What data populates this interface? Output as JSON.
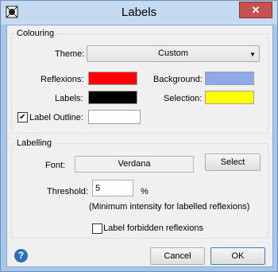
{
  "window": {
    "title": "Labels",
    "close_symbol": "✕"
  },
  "colouring": {
    "legend": "Colouring",
    "theme_label": "Theme:",
    "theme_value": "Custom",
    "reflexions_label": "Reflexions:",
    "labels_label": "Labels:",
    "label_outline_label": "Label Outline:",
    "label_outline_checked": true,
    "background_label": "Background:",
    "selection_label": "Selection:",
    "colors": {
      "reflexions": "#ff0000",
      "labels": "#000000",
      "label_outline": "#ffffff",
      "background": "#8ea8e8",
      "selection": "#ffff00"
    }
  },
  "labelling": {
    "legend": "Labelling",
    "font_label": "Font:",
    "font_value": "Verdana",
    "select_button": "Select",
    "threshold_label": "Threshold:",
    "threshold_value": "5",
    "threshold_unit": "%",
    "threshold_hint": "(Minimum intensity for labelled reflexions)",
    "forbidden_label": "Label forbidden reflexions",
    "forbidden_checked": false
  },
  "footer": {
    "cancel": "Cancel",
    "ok": "OK",
    "help_symbol": "?"
  },
  "icons": {
    "app": "app-icon",
    "help": "help-icon",
    "dropdown": "chevron-down-icon",
    "close": "close-icon"
  }
}
